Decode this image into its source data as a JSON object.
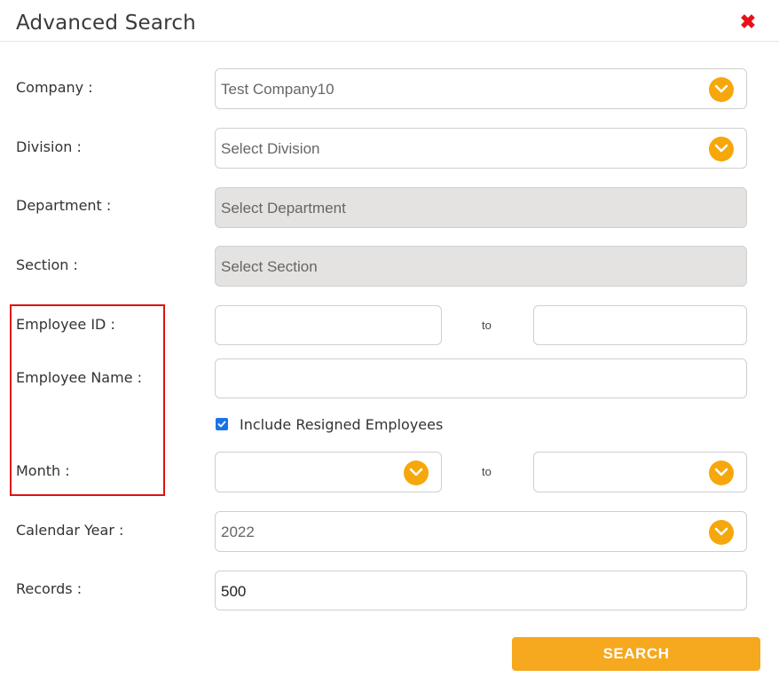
{
  "dialog": {
    "title": "Advanced Search",
    "close_icon": "close-icon"
  },
  "labels": {
    "company": "Company :",
    "division": "Division :",
    "department": "Department :",
    "section": "Section :",
    "employee_id": "Employee ID :",
    "employee_name": "Employee Name :",
    "month": "Month :",
    "calendar_year": "Calendar Year :",
    "records": "Records :"
  },
  "fields": {
    "company": "Test Company10",
    "division": "Select Division",
    "department": "Select Department",
    "section": "Select Section",
    "employee_id_from": "",
    "employee_id_to": "",
    "employee_name": "",
    "month_from": "",
    "month_to": "",
    "calendar_year": "2022",
    "records": "500"
  },
  "range_separator": "to",
  "include_resigned": {
    "label": "Include Resigned Employees",
    "checked": true
  },
  "search_button": "SEARCH",
  "colors": {
    "accent": "#f6a70b",
    "highlight_border": "#e01010",
    "close": "#e8101a",
    "disabled_bg": "#e5e2e2"
  }
}
